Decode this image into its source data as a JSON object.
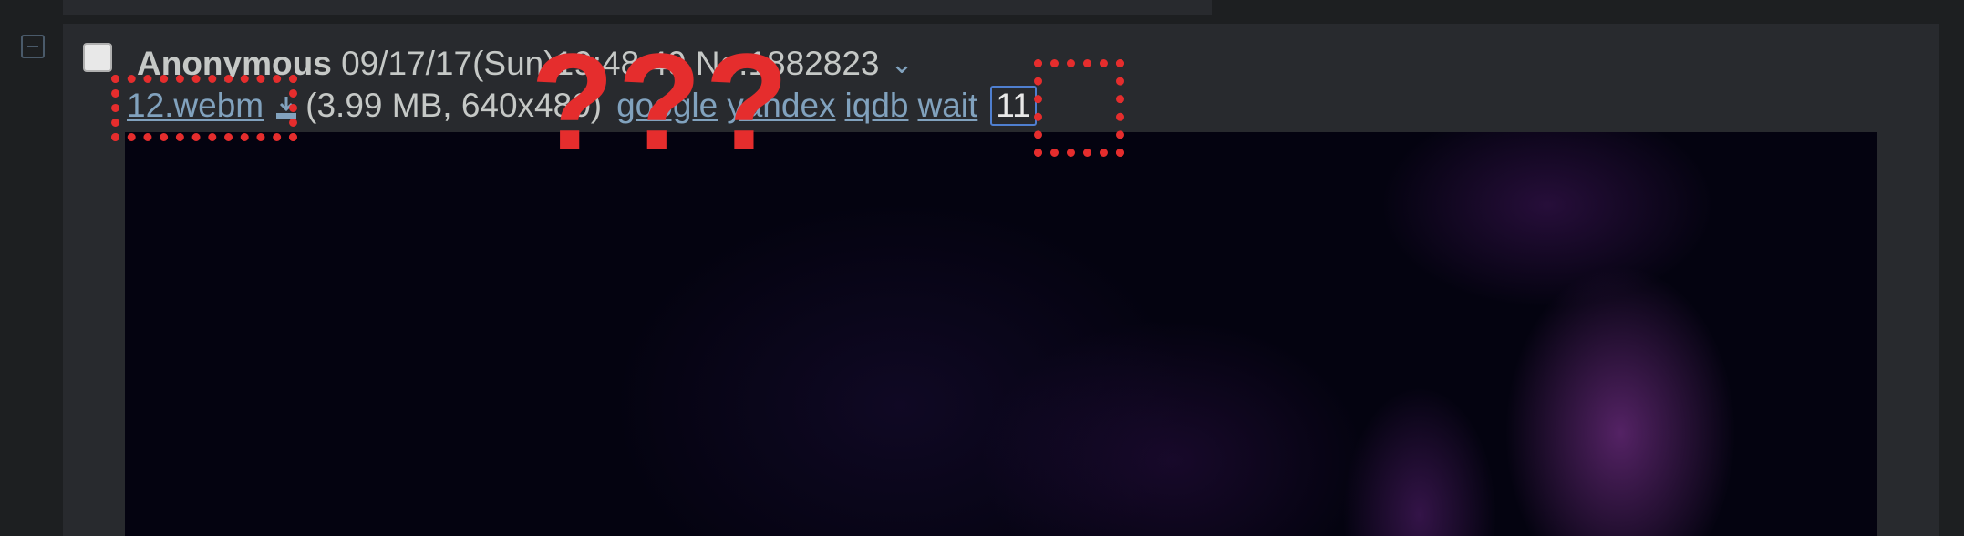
{
  "post": {
    "name": "Anonymous",
    "datetime": "09/17/17(Sun)19:48:49",
    "post_number": "No.1882823",
    "file": {
      "filename": "12.webm",
      "meta": "(3.99 MB, 640x480)",
      "search_links": [
        "google",
        "yandex",
        "iqdb",
        "wait"
      ],
      "counter": "11"
    }
  },
  "annotation": {
    "question_marks": "???",
    "color": "#e52d2d"
  },
  "colors": {
    "link": "#81a2be",
    "text": "#c5c8c6",
    "post_bg": "#282a2e",
    "page_bg": "#1d1f21"
  }
}
